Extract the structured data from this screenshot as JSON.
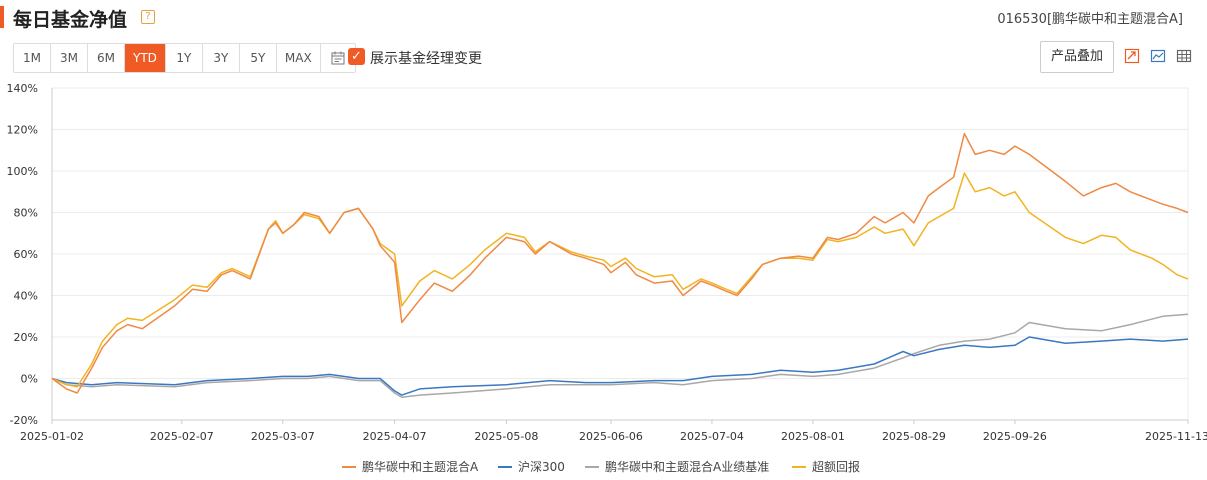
{
  "header": {
    "title": "每日基金净值",
    "help_icon": "?",
    "fund_code": "016530[鹏华碳中和主题混合A]"
  },
  "toolbar": {
    "ranges": [
      "1M",
      "3M",
      "6M",
      "YTD",
      "1Y",
      "3Y",
      "5Y",
      "MAX"
    ],
    "active_range": "YTD",
    "show_manager_label": "展示基金经理变更",
    "show_manager_checked": true,
    "overlay_label": "产品叠加",
    "icons": [
      "calendar-icon",
      "trend-arrow-icon",
      "chart-image-icon",
      "table-icon"
    ],
    "accent_color": "#f05a24"
  },
  "chart_data": {
    "type": "line",
    "ylim": [
      -20,
      140
    ],
    "y_ticks": [
      "140%",
      "120%",
      "100%",
      "80%",
      "60%",
      "40%",
      "20%",
      "0%",
      "-20%"
    ],
    "x_tick_labels": [
      "2025-01-02",
      "2025-02-07",
      "2025-03-07",
      "2025-04-07",
      "2025-05-08",
      "2025-06-06",
      "2025-07-04",
      "2025-08-01",
      "2025-08-29",
      "2025-09-26",
      "2025-11-13"
    ],
    "x_tick_dates": [
      "2025-01-02",
      "2025-02-07",
      "2025-03-07",
      "2025-04-07",
      "2025-05-08",
      "2025-06-06",
      "2025-07-04",
      "2025-08-01",
      "2025-08-29",
      "2025-09-26",
      "2025-11-13"
    ],
    "grid": true,
    "legend_position": "bottom",
    "series": [
      {
        "name": "鹏华碳中和主题混合A",
        "color": "#ef8a44",
        "points": [
          [
            "2025-01-02",
            0
          ],
          [
            "2025-01-06",
            -5
          ],
          [
            "2025-01-09",
            -7
          ],
          [
            "2025-01-13",
            5
          ],
          [
            "2025-01-16",
            15
          ],
          [
            "2025-01-20",
            23
          ],
          [
            "2025-01-23",
            26
          ],
          [
            "2025-01-27",
            24
          ],
          [
            "2025-02-05",
            35
          ],
          [
            "2025-02-10",
            43
          ],
          [
            "2025-02-14",
            42
          ],
          [
            "2025-02-18",
            50
          ],
          [
            "2025-02-21",
            52
          ],
          [
            "2025-02-26",
            48
          ],
          [
            "2025-03-03",
            72
          ],
          [
            "2025-03-05",
            75
          ],
          [
            "2025-03-07",
            70
          ],
          [
            "2025-03-10",
            74
          ],
          [
            "2025-03-13",
            80
          ],
          [
            "2025-03-17",
            78
          ],
          [
            "2025-03-20",
            70
          ],
          [
            "2025-03-24",
            80
          ],
          [
            "2025-03-28",
            82
          ],
          [
            "2025-04-01",
            72
          ],
          [
            "2025-04-03",
            64
          ],
          [
            "2025-04-07",
            56
          ],
          [
            "2025-04-09",
            27
          ],
          [
            "2025-04-14",
            38
          ],
          [
            "2025-04-18",
            46
          ],
          [
            "2025-04-23",
            42
          ],
          [
            "2025-04-28",
            50
          ],
          [
            "2025-05-02",
            58
          ],
          [
            "2025-05-08",
            68
          ],
          [
            "2025-05-13",
            66
          ],
          [
            "2025-05-16",
            60
          ],
          [
            "2025-05-20",
            66
          ],
          [
            "2025-05-26",
            60
          ],
          [
            "2025-05-30",
            58
          ],
          [
            "2025-06-04",
            55
          ],
          [
            "2025-06-06",
            51
          ],
          [
            "2025-06-10",
            56
          ],
          [
            "2025-06-13",
            50
          ],
          [
            "2025-06-18",
            46
          ],
          [
            "2025-06-23",
            47
          ],
          [
            "2025-06-26",
            40
          ],
          [
            "2025-07-01",
            47
          ],
          [
            "2025-07-04",
            45
          ],
          [
            "2025-07-08",
            42
          ],
          [
            "2025-07-11",
            40
          ],
          [
            "2025-07-15",
            48
          ],
          [
            "2025-07-18",
            55
          ],
          [
            "2025-07-23",
            58
          ],
          [
            "2025-07-28",
            59
          ],
          [
            "2025-08-01",
            58
          ],
          [
            "2025-08-05",
            68
          ],
          [
            "2025-08-08",
            67
          ],
          [
            "2025-08-13",
            70
          ],
          [
            "2025-08-18",
            78
          ],
          [
            "2025-08-21",
            75
          ],
          [
            "2025-08-26",
            80
          ],
          [
            "2025-08-29",
            75
          ],
          [
            "2025-09-02",
            88
          ],
          [
            "2025-09-05",
            92
          ],
          [
            "2025-09-09",
            97
          ],
          [
            "2025-09-12",
            118
          ],
          [
            "2025-09-15",
            108
          ],
          [
            "2025-09-19",
            110
          ],
          [
            "2025-09-23",
            108
          ],
          [
            "2025-09-26",
            112
          ],
          [
            "2025-09-30",
            108
          ],
          [
            "2025-10-10",
            95
          ],
          [
            "2025-10-15",
            88
          ],
          [
            "2025-10-20",
            92
          ],
          [
            "2025-10-24",
            94
          ],
          [
            "2025-10-28",
            90
          ],
          [
            "2025-11-03",
            86
          ],
          [
            "2025-11-06",
            84
          ],
          [
            "2025-11-10",
            82
          ],
          [
            "2025-11-13",
            80
          ]
        ]
      },
      {
        "name": "沪深300",
        "color": "#3b78c2",
        "points": [
          [
            "2025-01-02",
            0
          ],
          [
            "2025-01-06",
            -2
          ],
          [
            "2025-01-13",
            -3
          ],
          [
            "2025-01-20",
            -2
          ],
          [
            "2025-02-05",
            -3
          ],
          [
            "2025-02-14",
            -1
          ],
          [
            "2025-02-26",
            0
          ],
          [
            "2025-03-07",
            1
          ],
          [
            "2025-03-14",
            1
          ],
          [
            "2025-03-20",
            2
          ],
          [
            "2025-03-28",
            0
          ],
          [
            "2025-04-03",
            0
          ],
          [
            "2025-04-07",
            -6
          ],
          [
            "2025-04-09",
            -8
          ],
          [
            "2025-04-14",
            -5
          ],
          [
            "2025-04-23",
            -4
          ],
          [
            "2025-05-08",
            -3
          ],
          [
            "2025-05-20",
            -1
          ],
          [
            "2025-05-30",
            -2
          ],
          [
            "2025-06-06",
            -2
          ],
          [
            "2025-06-18",
            -1
          ],
          [
            "2025-06-26",
            -1
          ],
          [
            "2025-07-04",
            1
          ],
          [
            "2025-07-15",
            2
          ],
          [
            "2025-07-23",
            4
          ],
          [
            "2025-08-01",
            3
          ],
          [
            "2025-08-08",
            4
          ],
          [
            "2025-08-18",
            7
          ],
          [
            "2025-08-26",
            13
          ],
          [
            "2025-08-29",
            11
          ],
          [
            "2025-09-05",
            14
          ],
          [
            "2025-09-12",
            16
          ],
          [
            "2025-09-19",
            15
          ],
          [
            "2025-09-26",
            16
          ],
          [
            "2025-09-30",
            20
          ],
          [
            "2025-10-10",
            17
          ],
          [
            "2025-10-20",
            18
          ],
          [
            "2025-10-28",
            19
          ],
          [
            "2025-11-06",
            18
          ],
          [
            "2025-11-13",
            19
          ]
        ]
      },
      {
        "name": "鹏华碳中和主题混合A业绩基准",
        "color": "#a8a8a8",
        "points": [
          [
            "2025-01-02",
            0
          ],
          [
            "2025-01-06",
            -3
          ],
          [
            "2025-01-13",
            -4
          ],
          [
            "2025-01-20",
            -3
          ],
          [
            "2025-02-05",
            -4
          ],
          [
            "2025-02-14",
            -2
          ],
          [
            "2025-02-26",
            -1
          ],
          [
            "2025-03-07",
            0
          ],
          [
            "2025-03-14",
            0
          ],
          [
            "2025-03-20",
            1
          ],
          [
            "2025-03-28",
            -1
          ],
          [
            "2025-04-03",
            -1
          ],
          [
            "2025-04-07",
            -7
          ],
          [
            "2025-04-09",
            -9
          ],
          [
            "2025-04-14",
            -8
          ],
          [
            "2025-04-23",
            -7
          ],
          [
            "2025-05-08",
            -5
          ],
          [
            "2025-05-20",
            -3
          ],
          [
            "2025-05-30",
            -3
          ],
          [
            "2025-06-06",
            -3
          ],
          [
            "2025-06-18",
            -2
          ],
          [
            "2025-06-26",
            -3
          ],
          [
            "2025-07-04",
            -1
          ],
          [
            "2025-07-15",
            0
          ],
          [
            "2025-07-23",
            2
          ],
          [
            "2025-08-01",
            1
          ],
          [
            "2025-08-08",
            2
          ],
          [
            "2025-08-18",
            5
          ],
          [
            "2025-08-26",
            10
          ],
          [
            "2025-08-29",
            12
          ],
          [
            "2025-09-05",
            16
          ],
          [
            "2025-09-12",
            18
          ],
          [
            "2025-09-19",
            19
          ],
          [
            "2025-09-26",
            22
          ],
          [
            "2025-09-30",
            27
          ],
          [
            "2025-10-10",
            24
          ],
          [
            "2025-10-20",
            23
          ],
          [
            "2025-10-28",
            26
          ],
          [
            "2025-11-06",
            30
          ],
          [
            "2025-11-13",
            31
          ]
        ]
      },
      {
        "name": "超额回报",
        "color": "#f2b322",
        "points": [
          [
            "2025-01-02",
            0
          ],
          [
            "2025-01-06",
            -3
          ],
          [
            "2025-01-09",
            -4
          ],
          [
            "2025-01-13",
            7
          ],
          [
            "2025-01-16",
            18
          ],
          [
            "2025-01-20",
            26
          ],
          [
            "2025-01-23",
            29
          ],
          [
            "2025-01-27",
            28
          ],
          [
            "2025-02-05",
            38
          ],
          [
            "2025-02-10",
            45
          ],
          [
            "2025-02-14",
            44
          ],
          [
            "2025-02-18",
            51
          ],
          [
            "2025-02-21",
            53
          ],
          [
            "2025-02-26",
            49
          ],
          [
            "2025-03-03",
            72
          ],
          [
            "2025-03-05",
            76
          ],
          [
            "2025-03-07",
            70
          ],
          [
            "2025-03-10",
            74
          ],
          [
            "2025-03-13",
            79
          ],
          [
            "2025-03-17",
            77
          ],
          [
            "2025-03-20",
            70
          ],
          [
            "2025-03-24",
            80
          ],
          [
            "2025-03-28",
            82
          ],
          [
            "2025-04-01",
            72
          ],
          [
            "2025-04-03",
            65
          ],
          [
            "2025-04-07",
            60
          ],
          [
            "2025-04-09",
            35
          ],
          [
            "2025-04-14",
            47
          ],
          [
            "2025-04-18",
            52
          ],
          [
            "2025-04-23",
            48
          ],
          [
            "2025-04-28",
            55
          ],
          [
            "2025-05-02",
            62
          ],
          [
            "2025-05-08",
            70
          ],
          [
            "2025-05-13",
            68
          ],
          [
            "2025-05-16",
            61
          ],
          [
            "2025-05-20",
            66
          ],
          [
            "2025-05-26",
            61
          ],
          [
            "2025-05-30",
            59
          ],
          [
            "2025-06-04",
            57
          ],
          [
            "2025-06-06",
            54
          ],
          [
            "2025-06-10",
            58
          ],
          [
            "2025-06-13",
            53
          ],
          [
            "2025-06-18",
            49
          ],
          [
            "2025-06-23",
            50
          ],
          [
            "2025-06-26",
            43
          ],
          [
            "2025-07-01",
            48
          ],
          [
            "2025-07-04",
            46
          ],
          [
            "2025-07-08",
            43
          ],
          [
            "2025-07-11",
            41
          ],
          [
            "2025-07-15",
            49
          ],
          [
            "2025-07-18",
            55
          ],
          [
            "2025-07-23",
            58
          ],
          [
            "2025-07-28",
            58
          ],
          [
            "2025-08-01",
            57
          ],
          [
            "2025-08-05",
            67
          ],
          [
            "2025-08-08",
            66
          ],
          [
            "2025-08-13",
            68
          ],
          [
            "2025-08-18",
            73
          ],
          [
            "2025-08-21",
            70
          ],
          [
            "2025-08-26",
            72
          ],
          [
            "2025-08-29",
            64
          ],
          [
            "2025-09-02",
            75
          ],
          [
            "2025-09-05",
            78
          ],
          [
            "2025-09-09",
            82
          ],
          [
            "2025-09-12",
            99
          ],
          [
            "2025-09-15",
            90
          ],
          [
            "2025-09-19",
            92
          ],
          [
            "2025-09-23",
            88
          ],
          [
            "2025-09-26",
            90
          ],
          [
            "2025-09-30",
            80
          ],
          [
            "2025-10-10",
            68
          ],
          [
            "2025-10-15",
            65
          ],
          [
            "2025-10-20",
            69
          ],
          [
            "2025-10-24",
            68
          ],
          [
            "2025-10-28",
            62
          ],
          [
            "2025-11-03",
            58
          ],
          [
            "2025-11-06",
            55
          ],
          [
            "2025-11-10",
            50
          ],
          [
            "2025-11-13",
            48
          ]
        ]
      }
    ]
  }
}
